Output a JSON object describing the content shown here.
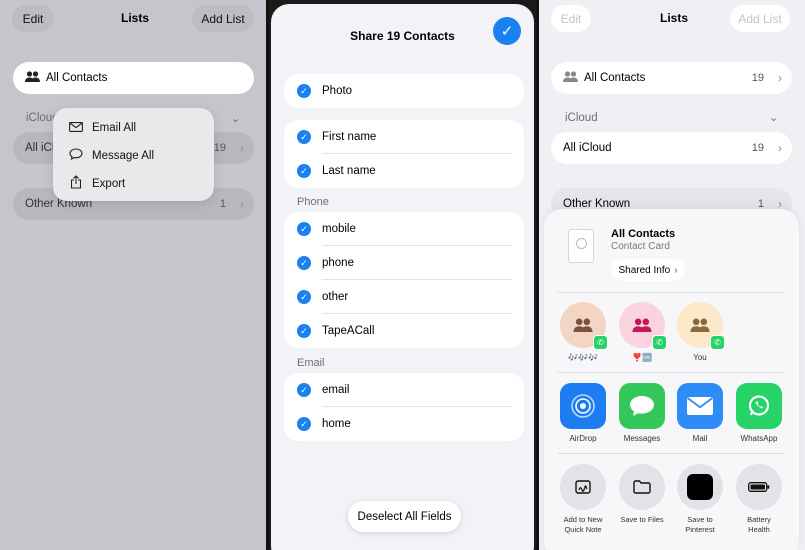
{
  "left_panel": {
    "edit": "Edit",
    "title": "Lists",
    "add_list": "Add List",
    "all_contacts": "All Contacts",
    "icloud_label": "iCloud",
    "all_icloud_partial": "All iCl",
    "all_icloud_count": "19",
    "other_known": "Other Known",
    "other_known_count": "1",
    "menu": {
      "email_all": "Email All",
      "message_all": "Message All",
      "export": "Export"
    }
  },
  "share_panel": {
    "title": "Share 19 Contacts",
    "photo": "Photo",
    "first_name": "First name",
    "last_name": "Last name",
    "phone_section": "Phone",
    "phone_items": [
      "mobile",
      "phone",
      "other",
      "TapeACall"
    ],
    "email_section": "Email",
    "email_items": [
      "email",
      "home"
    ],
    "deselect_all": "Deselect All Fields"
  },
  "right_panel": {
    "edit": "Edit",
    "title": "Lists",
    "add_list": "Add List",
    "all_contacts": "All Contacts",
    "all_contacts_count": "19",
    "icloud_label": "iCloud",
    "all_icloud": "All iCloud",
    "all_icloud_count": "19",
    "other_known": "Other Known",
    "other_known_count": "1",
    "share_sheet": {
      "card_title": "All Contacts",
      "card_subtitle": "Contact Card",
      "shared_info": "Shared Info",
      "people": [
        {
          "name": "🎶🎶🎶",
          "color": "#f3d5c4"
        },
        {
          "name": "❣️🆒",
          "color": "#f9d3de"
        },
        {
          "name": "You",
          "color": "#fbe9c9"
        }
      ],
      "apps": [
        {
          "name": "AirDrop",
          "color": "#1e7cf2",
          "icon": "airdrop-icon"
        },
        {
          "name": "Messages",
          "color": "#34c759",
          "icon": "messages-icon"
        },
        {
          "name": "Mail",
          "color": "#2d8cf5",
          "icon": "mail-icon"
        },
        {
          "name": "WhatsApp",
          "color": "#25d366",
          "icon": "whatsapp-icon"
        }
      ],
      "actions": [
        {
          "name": "Add to New Quick Note",
          "icon": "quick-note-icon"
        },
        {
          "name": "Save to Files",
          "icon": "folder-icon"
        },
        {
          "name": "Save to Pinterest",
          "icon": "pinterest-icon"
        },
        {
          "name": "Battery Health",
          "icon": "battery-icon"
        }
      ]
    }
  }
}
